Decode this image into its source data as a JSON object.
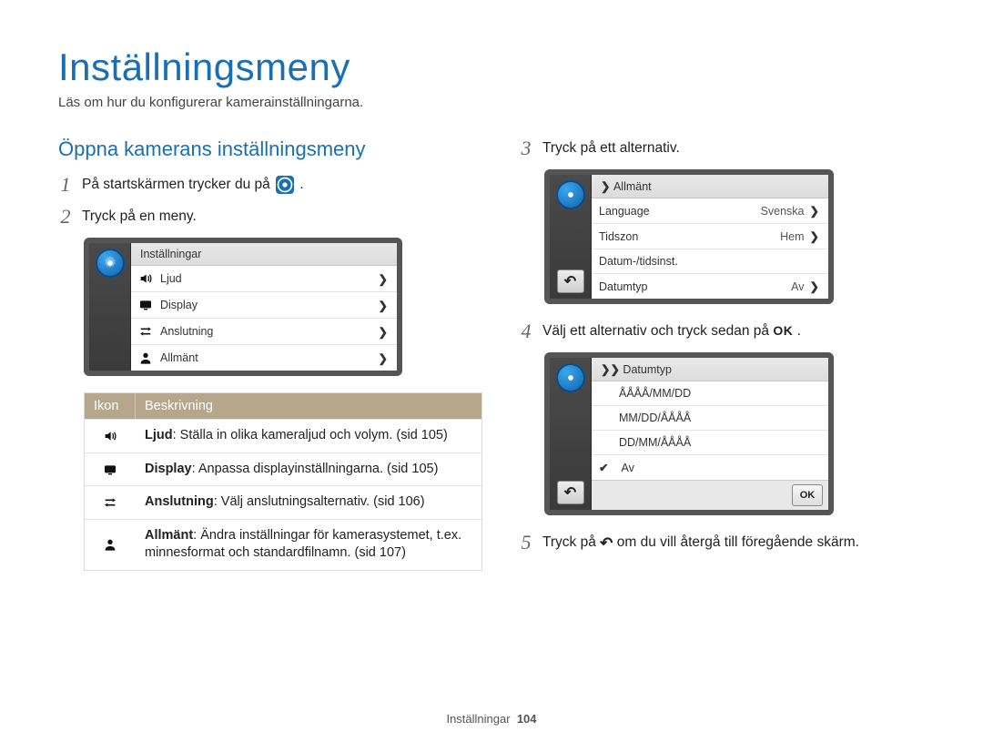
{
  "page": {
    "title": "Inställningsmeny",
    "intro": "Läs om hur du konfigurerar kamerainställningarna.",
    "subtitle": "Öppna kamerans inställningsmeny",
    "footer_label": "Inställningar",
    "footer_page": "104"
  },
  "left": {
    "step1_pre": "På startskärmen trycker du på ",
    "step1_post": ".",
    "step2": "Tryck på en meny.",
    "screen1": {
      "header": "Inställningar",
      "rows": [
        {
          "icon": "sound-icon",
          "label": "Ljud"
        },
        {
          "icon": "display-icon",
          "label": "Display"
        },
        {
          "icon": "connect-icon",
          "label": "Anslutning"
        },
        {
          "icon": "person-icon",
          "label": "Allmänt"
        }
      ]
    },
    "table": {
      "head_icon": "Ikon",
      "head_desc": "Beskrivning",
      "rows": [
        {
          "icon": "sound-icon",
          "bold": "Ljud",
          "text": ": Ställa in olika kameraljud och volym. (sid 105)"
        },
        {
          "icon": "display-icon",
          "bold": "Display",
          "text": ": Anpassa displayinställningarna. (sid 105)"
        },
        {
          "icon": "connect-icon",
          "bold": "Anslutning",
          "text": ": Välj anslutningsalternativ. (sid 106)"
        },
        {
          "icon": "person-icon",
          "bold": "Allmänt",
          "text": ": Ändra inställningar för kamerasystemet, t.ex. minnesformat och standardfilnamn. (sid 107)"
        }
      ]
    }
  },
  "right": {
    "step3": "Tryck på ett alternativ.",
    "screen2": {
      "breadcrumb": "Allmänt",
      "rows": [
        {
          "label": "Language",
          "value": "Svenska",
          "chev": true
        },
        {
          "label": "Tidszon",
          "value": "Hem",
          "chev": true
        },
        {
          "label": "Datum-/tidsinst.",
          "value": "",
          "chev": false
        },
        {
          "label": "Datumtyp",
          "value": "Av",
          "chev": true
        }
      ]
    },
    "step4_pre": "Välj ett alternativ och tryck sedan på ",
    "step4_post": ".",
    "ok_text": "OK",
    "screen3": {
      "breadcrumb": "Datumtyp",
      "options": [
        {
          "label": "ÅÅÅÅ/MM/DD",
          "checked": false
        },
        {
          "label": "MM/DD/ÅÅÅÅ",
          "checked": false
        },
        {
          "label": "DD/MM/ÅÅÅÅ",
          "checked": false
        },
        {
          "label": "Av",
          "checked": true
        }
      ],
      "ok": "OK"
    },
    "step5_pre": "Tryck på ",
    "step5_post": " om du vill återgå till föregående skärm."
  }
}
